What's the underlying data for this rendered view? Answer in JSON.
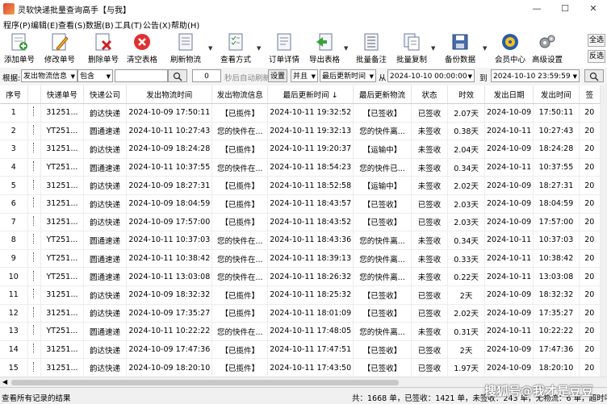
{
  "window": {
    "title": "灵软快递批量查询高手【与我】",
    "minimize": "—",
    "maximize": "☐",
    "close": "✕"
  },
  "menu": [
    "程序(P)",
    "编辑(E)",
    "查看(S)",
    "数据(B)",
    "工具(T)",
    "公告(X)",
    "帮助(H)"
  ],
  "toolbar": {
    "items": [
      {
        "label": "添加单号",
        "icon": "add-icon"
      },
      {
        "label": "修改单号",
        "icon": "edit-icon"
      },
      {
        "label": "删除单号",
        "icon": "delete-icon"
      },
      {
        "label": "清空表格",
        "icon": "clear-icon"
      },
      {
        "label": "刷新物流",
        "icon": "refresh-icon"
      },
      {
        "label": "查看方式",
        "icon": "view-icon"
      },
      {
        "label": "订单详情",
        "icon": "detail-icon"
      },
      {
        "label": "导出表格",
        "icon": "export-icon"
      },
      {
        "label": "批量备注",
        "icon": "note-icon"
      },
      {
        "label": "批量复制",
        "icon": "copy-icon"
      },
      {
        "label": "备份数据",
        "icon": "backup-icon"
      },
      {
        "label": "会员中心",
        "icon": "member-icon"
      },
      {
        "label": "高级设置",
        "icon": "settings-icon"
      }
    ],
    "select_all": "全选",
    "invert": "反选"
  },
  "filter": {
    "according_label": "根据:",
    "field": "发出物流信息",
    "match": "包含",
    "keyword": "",
    "interval": "0",
    "auto_refresh_label": "秒后自动刷新",
    "settings_button": "设置",
    "logic": "并且",
    "time_field": "最后更新时间",
    "from_label": "从",
    "from_value": "2024-10-10 00:00:00",
    "to_label": "到",
    "to_value": "2024-10-10 23:59:59"
  },
  "table": {
    "columns": [
      "序号",
      "",
      "快递单号",
      "快递公司",
      "发出物流时间",
      "发出物流信息",
      "最后更新时间 ↓",
      "最后更新物流",
      "状态",
      "时效",
      "发出日期",
      "发出时间",
      "签"
    ],
    "rows": [
      [
        "1",
        "",
        "31251...",
        "韵达快递",
        "2024-10-09 17:50:11",
        "【已揽件】",
        "2024-10-11 19:32:52",
        "【已签收】",
        "已签收",
        "2.07天",
        "2024-10-09",
        "17:50:11",
        "20"
      ],
      [
        "2",
        "",
        "YT251...",
        "圆通速递",
        "2024-10-11 10:27:43",
        "您的快件在...",
        "2024-10-11 19:32:13",
        "您的快件离...",
        "未签收",
        "0.38天",
        "2024-10-11",
        "10:27:43",
        "20"
      ],
      [
        "3",
        "",
        "31251...",
        "韵达快递",
        "2024-10-09 18:24:28",
        "【已揽件】",
        "2024-10-11 19:20:37",
        "【运输中】",
        "未签收",
        "2.04天",
        "2024-10-09",
        "18:24:28",
        "20"
      ],
      [
        "4",
        "",
        "YT251...",
        "圆通速递",
        "2024-10-11 10:37:55",
        "您的快件在...",
        "2024-10-11 18:54:23",
        "您的快件已...",
        "未签收",
        "0.34天",
        "2024-10-11",
        "10:37:55",
        "20"
      ],
      [
        "5",
        "",
        "31251...",
        "韵达快递",
        "2024-10-09 18:27:31",
        "【已揽件】",
        "2024-10-11 18:52:58",
        "【运输中】",
        "未签收",
        "2.02天",
        "2024-10-09",
        "18:27:31",
        "20"
      ],
      [
        "6",
        "",
        "31251...",
        "韵达快递",
        "2024-10-09 18:04:59",
        "【已揽件】",
        "2024-10-11 18:43:57",
        "【已签收】",
        "已签收",
        "2.03天",
        "2024-10-09",
        "18:04:59",
        "20"
      ],
      [
        "7",
        "",
        "31251...",
        "韵达快递",
        "2024-10-09 17:57:00",
        "【已揽件】",
        "2024-10-11 18:43:52",
        "【已签收】",
        "已签收",
        "2.03天",
        "2024-10-09",
        "17:57:00",
        "20"
      ],
      [
        "8",
        "",
        "YT251...",
        "圆通速递",
        "2024-10-11 10:37:03",
        "您的快件在...",
        "2024-10-11 18:43:36",
        "您的快件离...",
        "未签收",
        "0.34天",
        "2024-10-11",
        "10:37:03",
        "20"
      ],
      [
        "9",
        "",
        "YT251...",
        "圆通速递",
        "2024-10-11 10:38:42",
        "您的快件在...",
        "2024-10-11 18:39:13",
        "您的快件离...",
        "未签收",
        "0.33天",
        "2024-10-11",
        "10:38:42",
        "20"
      ],
      [
        "10",
        "",
        "YT251...",
        "圆通速递",
        "2024-10-11 13:03:08",
        "您的快件在...",
        "2024-10-11 18:26:32",
        "您的快件离...",
        "未签收",
        "0.22天",
        "2024-10-11",
        "13:03:08",
        "20"
      ],
      [
        "11",
        "",
        "31251...",
        "韵达快递",
        "2024-10-09 18:32:32",
        "【已揽件】",
        "2024-10-11 18:25:32",
        "【已签收】",
        "已签收",
        "2天",
        "2024-10-09",
        "18:32:32",
        "20"
      ],
      [
        "12",
        "",
        "31251...",
        "韵达快递",
        "2024-10-09 17:35:27",
        "【已揽件】",
        "2024-10-11 18:01:09",
        "【已签收】",
        "已签收",
        "2.02天",
        "2024-10-09",
        "17:35:27",
        "20"
      ],
      [
        "13",
        "",
        "YT251...",
        "圆通速递",
        "2024-10-11 10:22:22",
        "您的快件在...",
        "2024-10-11 17:48:05",
        "您的快件离...",
        "未签收",
        "0.31天",
        "2024-10-11",
        "10:22:22",
        "20"
      ],
      [
        "14",
        "",
        "31251...",
        "韵达快递",
        "2024-10-09 17:47:36",
        "【已揽件】",
        "2024-10-11 17:47:51",
        "【已签收】",
        "已签收",
        "2天",
        "2024-10-09",
        "17:47:36",
        "20"
      ],
      [
        "15",
        "",
        "31251...",
        "韵达快递",
        "2024-10-09 18:20:10",
        "【已揽件】",
        "2024-10-11 17:43:50",
        "【已签收】",
        "已签收",
        "1.97天",
        "2024-10-09",
        "18:20:10",
        "20"
      ]
    ]
  },
  "status": {
    "left": "查看所有记录的结果",
    "right": "共：1668 单，已签收：1421 单，未签收：243 单，无物流：6 单，超时叫"
  },
  "watermark": "搜狐号@我才是豆豆"
}
